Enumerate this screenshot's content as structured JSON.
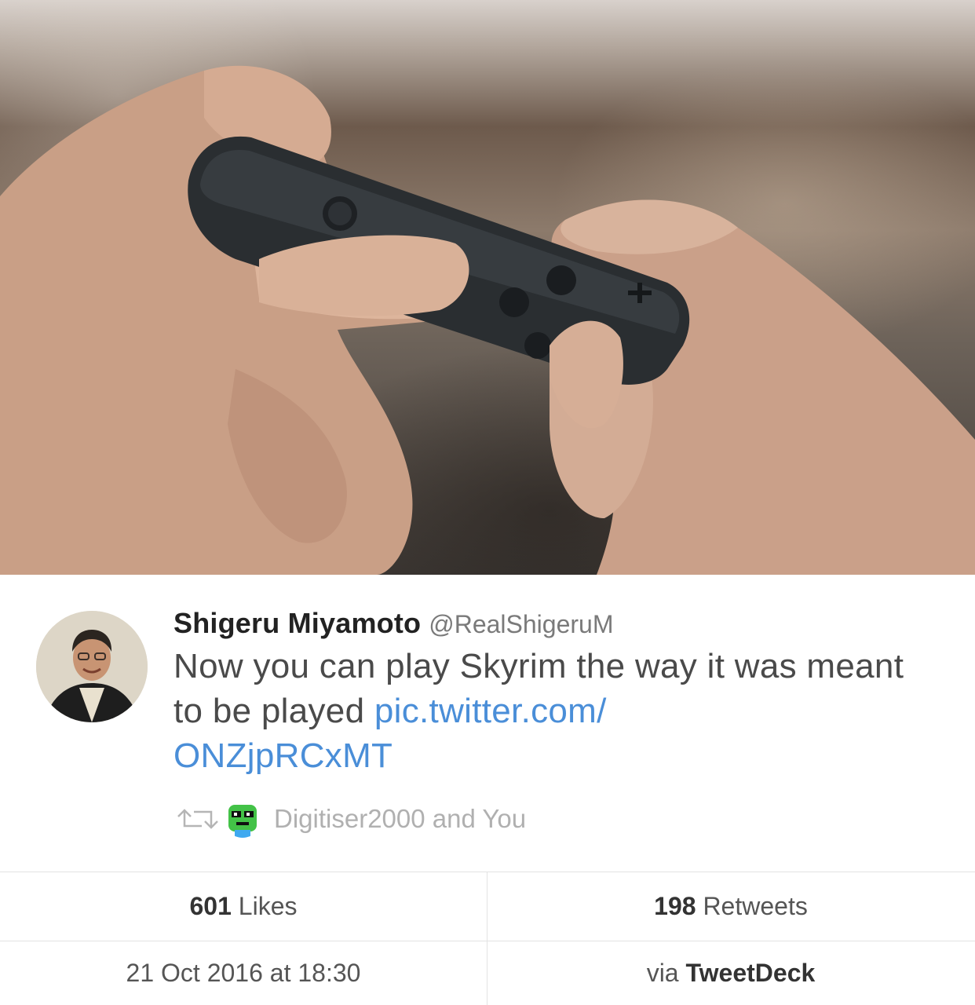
{
  "tweet": {
    "display_name": "Shigeru Miyamoto",
    "handle": "@RealShigeruM",
    "text_before_link": "Now you can play Skyrim the way it was meant to be played ",
    "link_text": "pic.twitter.com/\nONZjpRCxMT",
    "link_line1": "pic.twitter.com/",
    "link_line2": "ONZjpRCxMT"
  },
  "retweeted_by": {
    "text": "Digitiser2000 and You"
  },
  "stats": {
    "likes_count": "601",
    "likes_label": " Likes",
    "retweets_count": "198",
    "retweets_label": " Retweets",
    "timestamp": "21 Oct 2016 at 18:30",
    "via_prefix": "via ",
    "via_client": "TweetDeck"
  },
  "colors": {
    "link": "#4a8ed8",
    "muted": "#b0b0b0",
    "divider": "#e3e3e3"
  },
  "icons": {
    "retweet": "retweet-icon",
    "avatar": "profile-avatar",
    "retweeter_avatar": "retweeter-avatar"
  }
}
